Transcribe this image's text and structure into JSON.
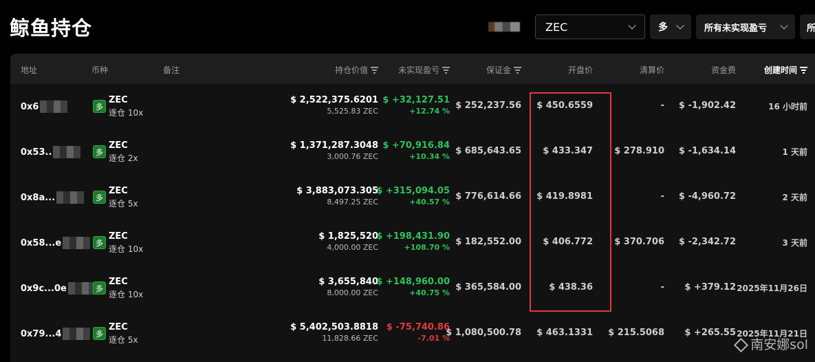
{
  "page_title": "鲸鱼持仓",
  "filters": {
    "coin": "ZEC",
    "direction": "多",
    "pnl": "所有未实现盈亏",
    "more": "所"
  },
  "columns": {
    "address": "地址",
    "coin": "币种",
    "note": "备注",
    "position_value": "持仓价值",
    "unrealized_pnl": "未实现盈亏",
    "margin": "保证金",
    "entry_price": "开盘价",
    "liq_price": "清算价",
    "funding": "资金费",
    "created": "创建时间"
  },
  "rows": [
    {
      "address": "0x6",
      "side": "多",
      "coin": "ZEC",
      "leverage": "逐仓 10x",
      "value": "$ 2,522,375.6201",
      "size": "5,525.83 ZEC",
      "pnl": "$ +32,127.51",
      "pnl_pct": "+12.74 %",
      "pnl_color": "green",
      "margin": "$ 252,237.56",
      "entry": "$ 450.6559",
      "liq": "-",
      "funding": "$ -1,902.42",
      "funding_color": "red",
      "time": "16 小时前"
    },
    {
      "address": "0x53..",
      "side": "多",
      "coin": "ZEC",
      "leverage": "逐仓 2x",
      "value": "$ 1,371,287.3048",
      "size": "3,000.76 ZEC",
      "pnl": "$ +70,916.84",
      "pnl_pct": "+10.34 %",
      "pnl_color": "green",
      "margin": "$ 685,643.65",
      "entry": "$ 433.347",
      "liq": "$ 278.910",
      "funding": "$ -1,634.14",
      "funding_color": "red",
      "time": "1 天前"
    },
    {
      "address": "0x8a...",
      "side": "多",
      "coin": "ZEC",
      "leverage": "逐仓 5x",
      "value": "$ 3,883,073.305",
      "size": "8,497.25 ZEC",
      "pnl": "$ +315,094.05",
      "pnl_pct": "+40.57 %",
      "pnl_color": "green",
      "margin": "$ 776,614.66",
      "entry": "$ 419.8981",
      "liq": "-",
      "funding": "$ -4,960.72",
      "funding_color": "red",
      "time": "2 天前"
    },
    {
      "address": "0x58...e",
      "side": "多",
      "coin": "ZEC",
      "leverage": "逐仓 10x",
      "value": "$ 1,825,520",
      "size": "4,000.00 ZEC",
      "pnl": "$ +198,431.90",
      "pnl_pct": "+108.70 %",
      "pnl_color": "green",
      "margin": "$ 182,552.00",
      "entry": "$ 406.772",
      "liq": "$ 370.706",
      "funding": "$ -2,342.72",
      "funding_color": "red",
      "time": "3 天前"
    },
    {
      "address": "0x9c...0e",
      "side": "多",
      "coin": "ZEC",
      "leverage": "逐仓 10x",
      "value": "$ 3,655,840",
      "size": "8,000.00 ZEC",
      "pnl": "$ +148,960.00",
      "pnl_pct": "+40.75 %",
      "pnl_color": "green",
      "margin": "$ 365,584.00",
      "entry": "$ 438.36",
      "liq": "-",
      "funding": "$ +379.12",
      "funding_color": "green",
      "time": "2025年11月26日"
    },
    {
      "address": "0x79...4",
      "side": "多",
      "coin": "ZEC",
      "leverage": "逐仓 5x",
      "value": "$ 5,402,503.8818",
      "size": "11,828.66 ZEC",
      "pnl": "$ -75,740.86",
      "pnl_pct": "-7.01 %",
      "pnl_color": "red",
      "margin": "$ 1,080,500.78",
      "entry": "$ 463.1331",
      "liq": "$ 215.5068",
      "funding": "$ +265.55",
      "funding_color": "green",
      "time": "2025年11月21日"
    }
  ],
  "watermark": "南安娜sol",
  "colors": {
    "positive": "#2ec25a",
    "negative": "#e23b3b",
    "highlight": "#e03c3c",
    "long_badge": "#1f7a2d"
  }
}
